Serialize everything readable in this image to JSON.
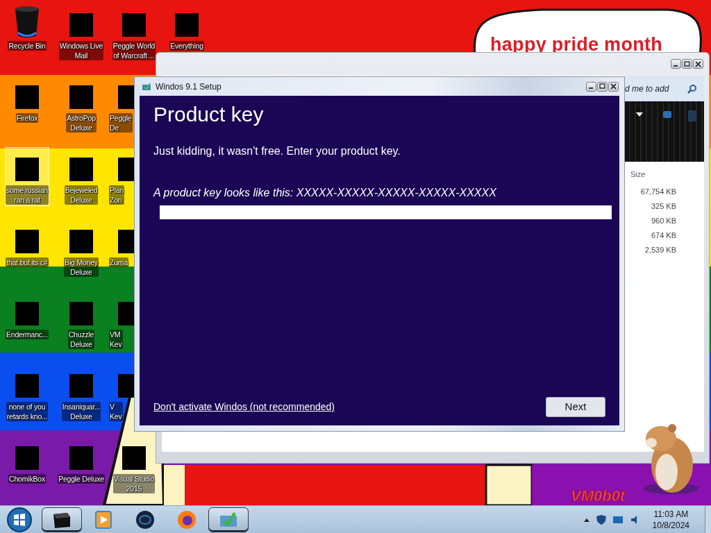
{
  "wallpaper_texts": [
    "happy pride month",
    "VM0b0t"
  ],
  "desktop_columns": [
    [
      {
        "label": "Recycle Bin",
        "kind": "bin",
        "selected": false
      },
      {
        "label": "Firefox",
        "kind": "blocked",
        "selected": false
      },
      {
        "label": "some russian\nran a rat",
        "kind": "blocked",
        "selected": true
      },
      {
        "label": "that but its c#",
        "kind": "blocked",
        "selected": false
      },
      {
        "label": "Endermanc...",
        "kind": "blocked",
        "selected": false
      },
      {
        "label": "none of you\nretards kno...",
        "kind": "blocked",
        "selected": false
      },
      {
        "label": "ChomikBox",
        "kind": "blocked",
        "selected": false
      }
    ],
    [
      {
        "label": "Windows Live\nMail",
        "kind": "blocked",
        "selected": false
      },
      {
        "label": "AstroPop\nDeluxe",
        "kind": "blocked",
        "selected": false
      },
      {
        "label": "Bejeweled\nDeluxe",
        "kind": "blocked",
        "selected": false
      },
      {
        "label": "Big Money\nDeluxe",
        "kind": "blocked",
        "selected": false
      },
      {
        "label": "Chuzzle\nDeluxe",
        "kind": "blocked",
        "selected": false
      },
      {
        "label": "Insaniquar...\nDeluxe",
        "kind": "blocked",
        "selected": false
      },
      {
        "label": "Peggle Deluxe",
        "kind": "blocked",
        "selected": false
      }
    ],
    [
      {
        "label": "Peggle World\nof Warcraft ...",
        "kind": "blocked",
        "selected": false
      },
      {
        "label": "Peggle\nDe",
        "kind": "partial",
        "selected": false
      },
      {
        "label": "Plan\nZon",
        "kind": "partial",
        "selected": false
      },
      {
        "label": "Zuma",
        "kind": "partial",
        "selected": false
      },
      {
        "label": "VM\nKev",
        "kind": "partial",
        "selected": false
      },
      {
        "label": "V\nKev",
        "kind": "partial",
        "selected": false
      },
      {
        "label": "Visual Studio\n2015",
        "kind": "blocked",
        "selected": false
      }
    ],
    [
      {
        "label": "Everything",
        "kind": "blocked",
        "selected": false
      }
    ]
  ],
  "explorer": {
    "search_placeholder": "d me to add",
    "columns": [
      "Size"
    ],
    "rows": [
      {
        "size": "67,754 KB"
      },
      {
        "size": "325 KB"
      },
      {
        "size": "960 KB"
      },
      {
        "size": "674 KB"
      },
      {
        "size": "2,539 KB"
      }
    ]
  },
  "setup": {
    "title": "Windos 9.1 Setup",
    "heading": "Product key",
    "subtitle": "Just kidding, it wasn't free. Enter your product key.",
    "hint": "A product key looks like this: XXXXX-XXXXX-XXXXX-XXXXX-XXXXX",
    "skip_link": "Don't activate Windos (not recommended)",
    "next_button": "Next"
  },
  "taskbar": {
    "items": [
      {
        "kind": "folder",
        "selected": true
      },
      {
        "kind": "media",
        "selected": false
      },
      {
        "kind": "globe",
        "selected": false
      },
      {
        "kind": "firefox",
        "selected": false
      },
      {
        "kind": "setup",
        "selected": true
      }
    ],
    "time": "11:03 AM",
    "date": "10/8/2024"
  }
}
